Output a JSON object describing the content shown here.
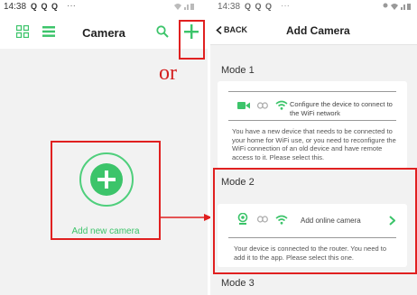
{
  "left": {
    "status": {
      "time": "14:38",
      "notif": "Q Q Q",
      "dots": "···"
    },
    "header": {
      "title": "Camera"
    },
    "or_text": "or",
    "add_label": "Add new camera",
    "colors": {
      "accent": "#3cc46a",
      "highlight": "#e02020"
    },
    "icons": [
      "grid-view-icon",
      "list-view-icon",
      "search-icon",
      "plus-icon"
    ]
  },
  "right": {
    "status": {
      "time": "14:38",
      "notif": "Q Q Q",
      "dots": "···"
    },
    "header": {
      "back_label": "BACK",
      "title": "Add Camera"
    },
    "mode1": {
      "label": "Mode 1",
      "option": "Configure the device to connect to the WiFi network",
      "description": "You have a new device that needs to be connected to your home for WiFi use, or you need to reconfigure the WiFi connection of an old device and have remote access to it. Please select this."
    },
    "mode2": {
      "label": "Mode 2",
      "option": "Add online camera",
      "description": "Your device is connected to the router. You need to add it to the app. Please select this one."
    },
    "mode3": {
      "label": "Mode 3"
    }
  }
}
